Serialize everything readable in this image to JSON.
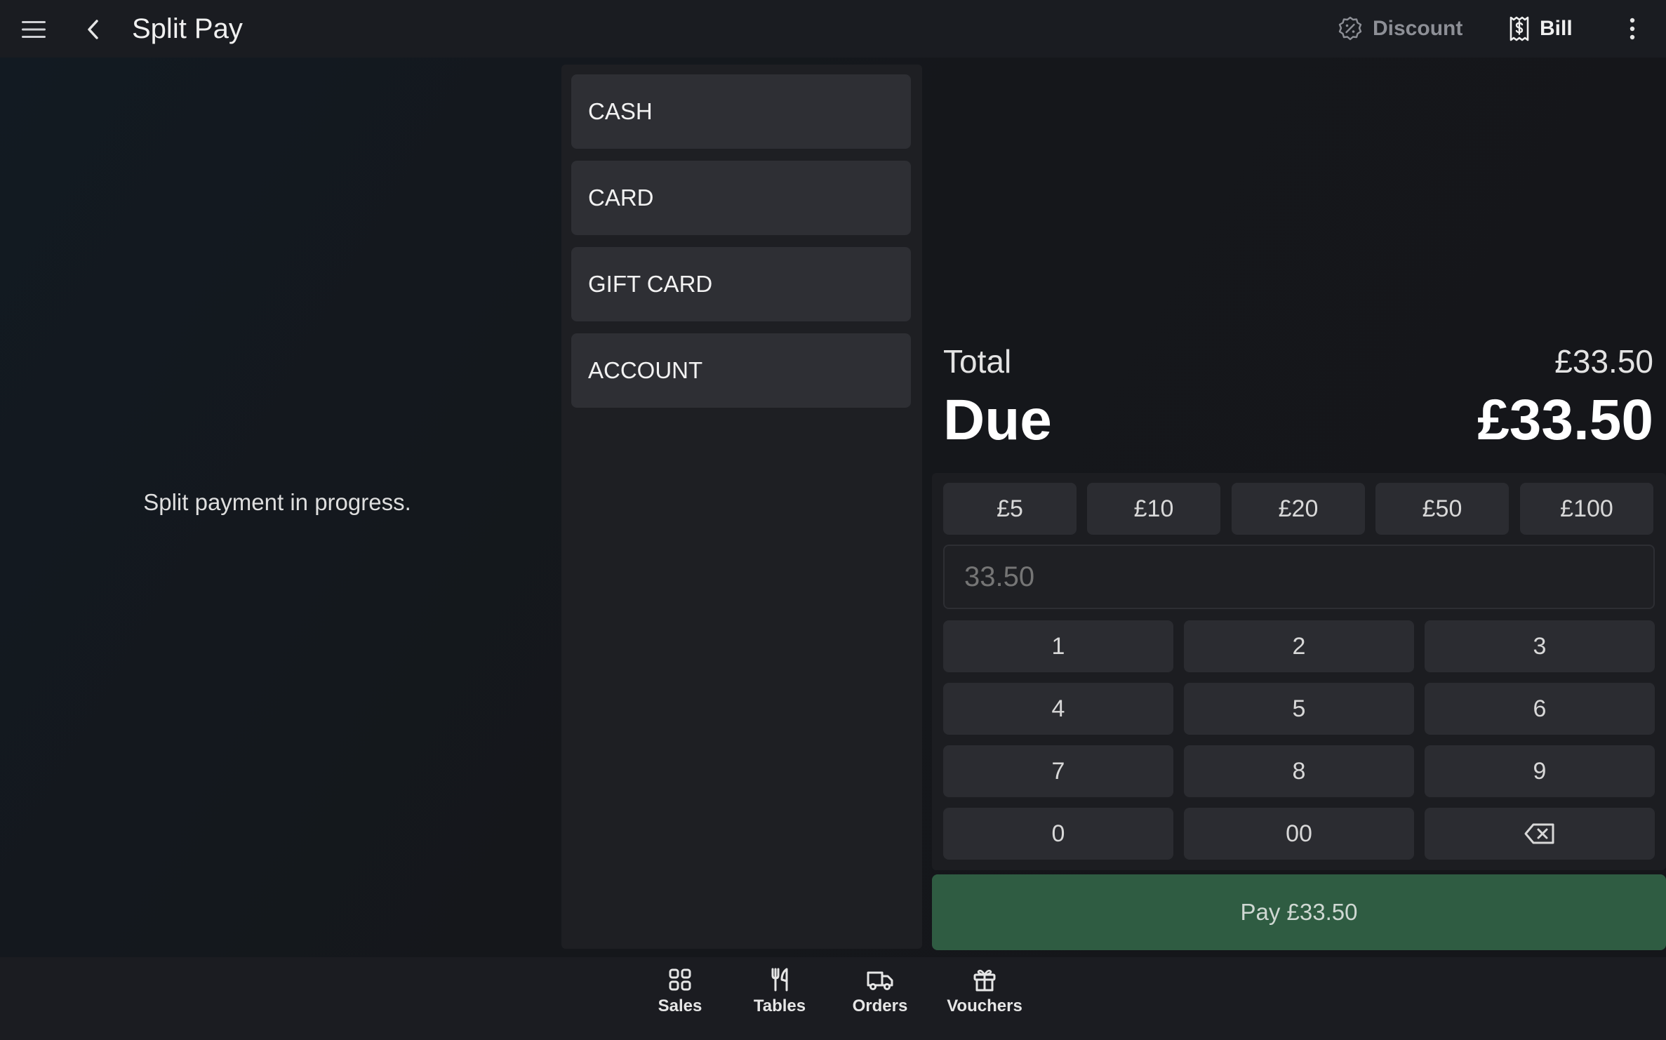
{
  "header": {
    "title": "Split Pay",
    "menu_icon": "hamburger-menu-icon",
    "back_icon": "chevron-left-icon",
    "discount_label": "Discount",
    "bill_label": "Bill",
    "more_icon": "kebab-menu-icon"
  },
  "left_panel": {
    "status_text": "Split payment in progress."
  },
  "tenders": [
    {
      "label": "CASH"
    },
    {
      "label": "CARD"
    },
    {
      "label": "GIFT CARD"
    },
    {
      "label": "ACCOUNT"
    }
  ],
  "summary": {
    "total_label": "Total",
    "total_value": "£33.50",
    "due_label": "Due",
    "due_value": "£33.50"
  },
  "quick_amounts": [
    "£5",
    "£10",
    "£20",
    "£50",
    "£100"
  ],
  "amount_input": {
    "placeholder": "33.50"
  },
  "keypad": [
    "1",
    "2",
    "3",
    "4",
    "5",
    "6",
    "7",
    "8",
    "9",
    "0",
    "00"
  ],
  "pay_button": "Pay £33.50",
  "nav": [
    {
      "label": "Sales",
      "icon": "grid-icon"
    },
    {
      "label": "Tables",
      "icon": "fork-knife-icon"
    },
    {
      "label": "Orders",
      "icon": "delivery-truck-icon"
    },
    {
      "label": "Vouchers",
      "icon": "gift-icon"
    }
  ],
  "colors": {
    "background": "#15171b",
    "panel": "#1e1f23",
    "button": "#2e2f34",
    "pay_green": "#2f5c42"
  }
}
